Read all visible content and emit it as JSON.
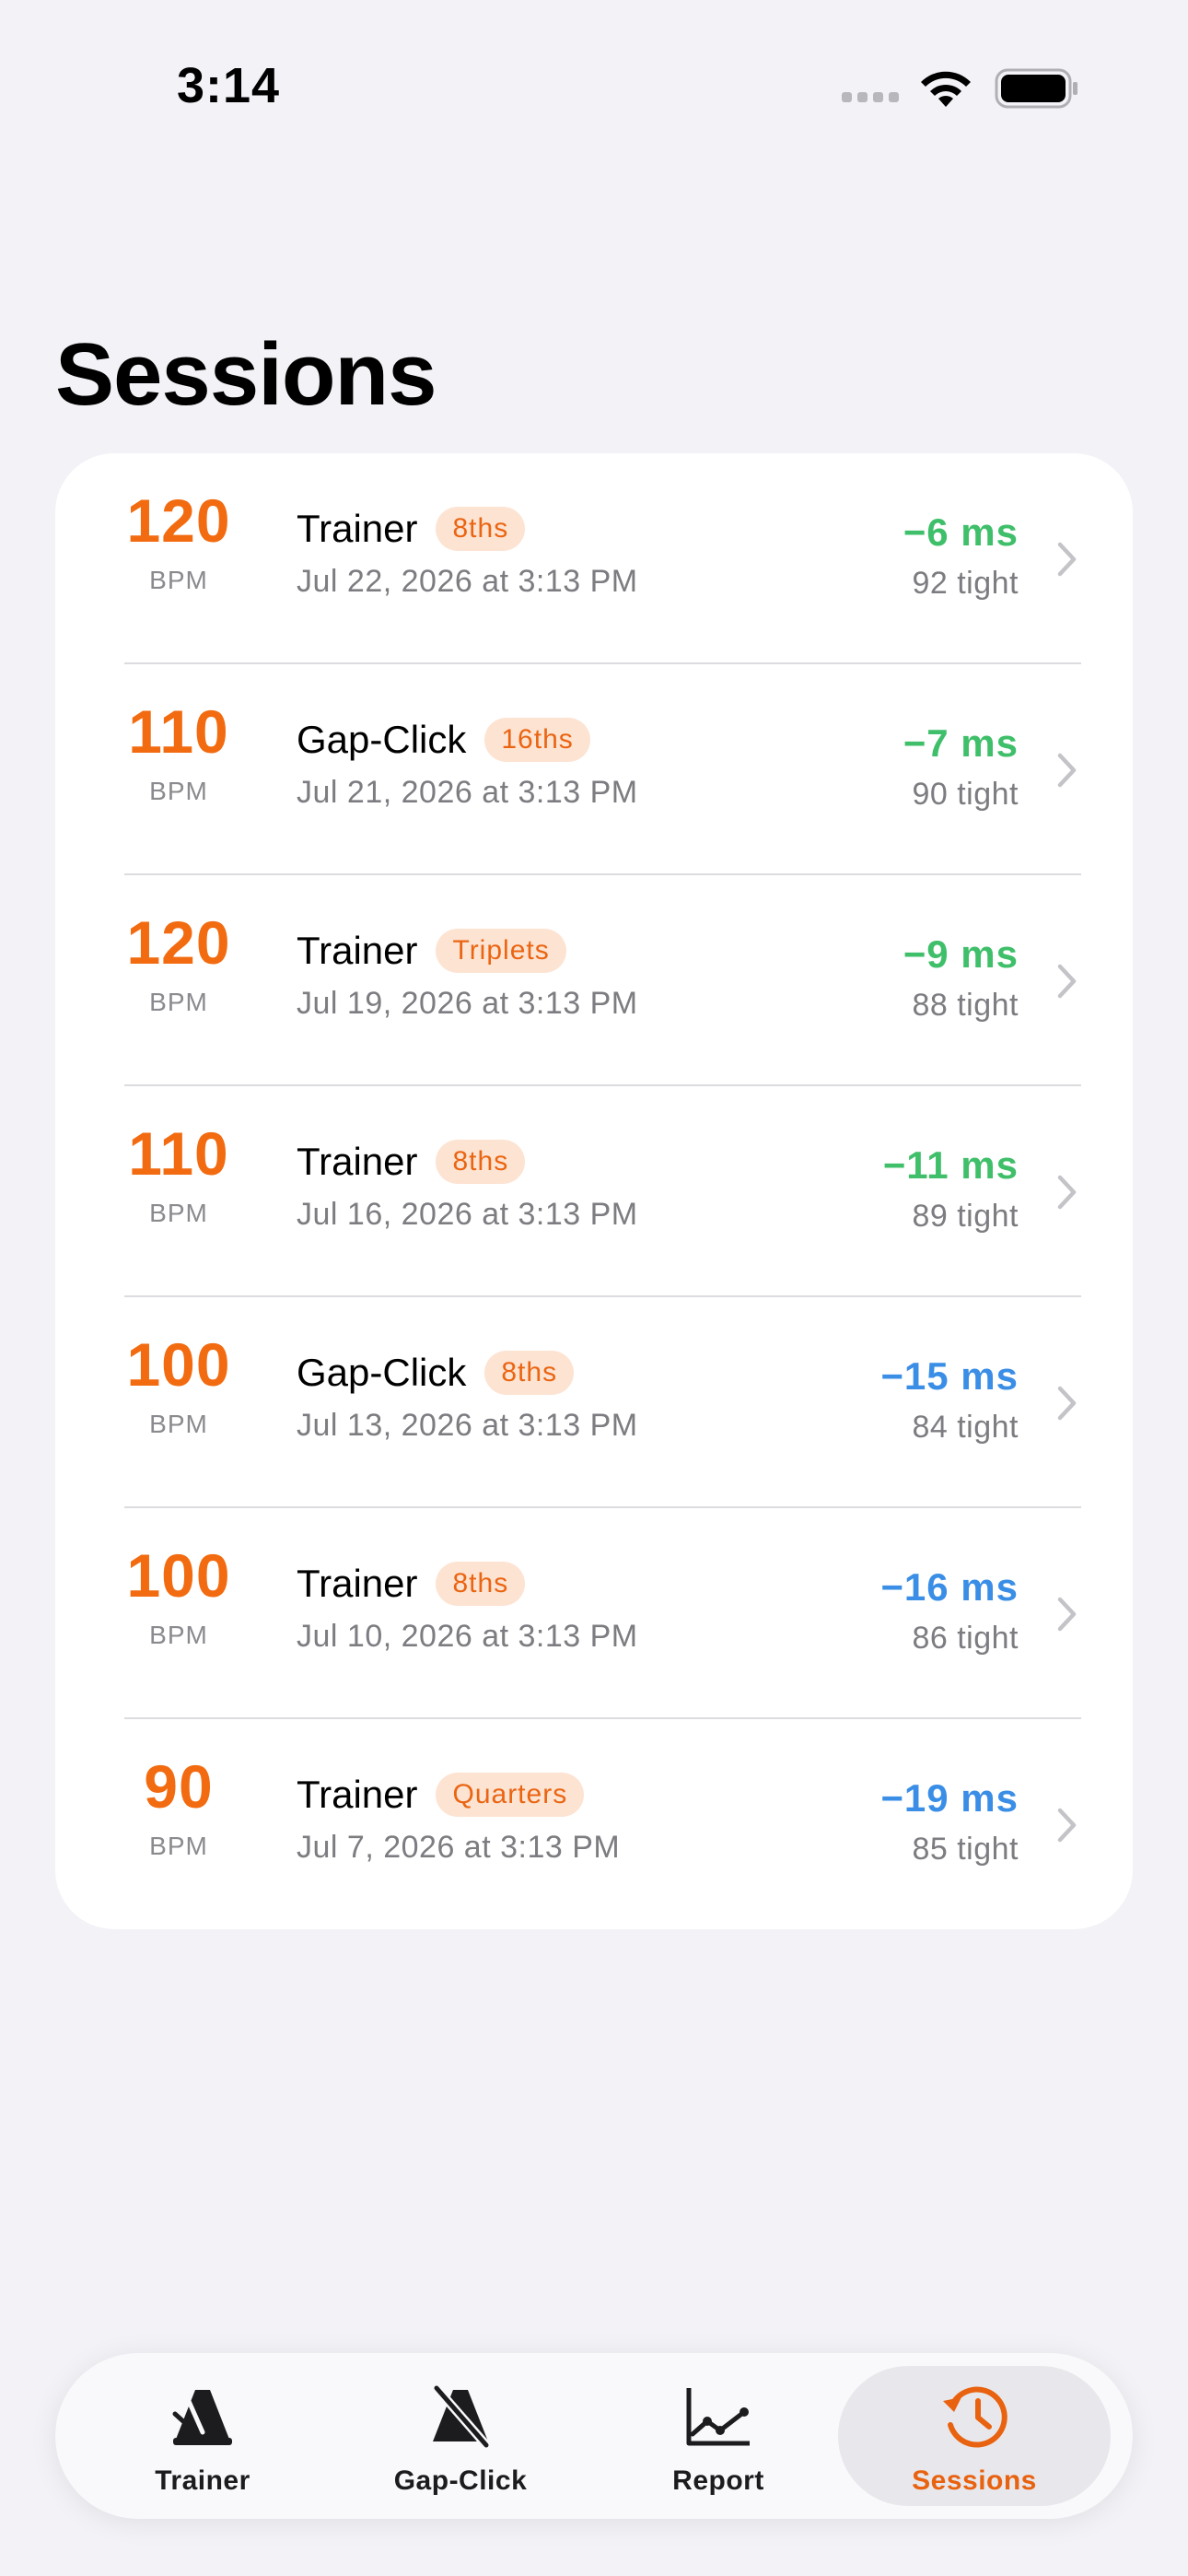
{
  "status_bar": {
    "time": "3:14"
  },
  "page": {
    "title": "Sessions"
  },
  "sessions": [
    {
      "bpm": "120",
      "unit": "BPM",
      "name": "Trainer",
      "subdivision": "8ths",
      "date": "Jul 22, 2026 at 3:13 PM",
      "offset": "−6 ms",
      "tight": "92 tight",
      "offset_color": "#3fbf6a"
    },
    {
      "bpm": "110",
      "unit": "BPM",
      "name": "Gap-Click",
      "subdivision": "16ths",
      "date": "Jul 21, 2026 at 3:13 PM",
      "offset": "−7 ms",
      "tight": "90 tight",
      "offset_color": "#3fbf6a"
    },
    {
      "bpm": "120",
      "unit": "BPM",
      "name": "Trainer",
      "subdivision": "Triplets",
      "date": "Jul 19, 2026 at 3:13 PM",
      "offset": "−9 ms",
      "tight": "88 tight",
      "offset_color": "#3fbf6a"
    },
    {
      "bpm": "110",
      "unit": "BPM",
      "name": "Trainer",
      "subdivision": "8ths",
      "date": "Jul 16, 2026 at 3:13 PM",
      "offset": "−11 ms",
      "tight": "89 tight",
      "offset_color": "#3fbf6a"
    },
    {
      "bpm": "100",
      "unit": "BPM",
      "name": "Gap-Click",
      "subdivision": "8ths",
      "date": "Jul 13, 2026 at 3:13 PM",
      "offset": "−15 ms",
      "tight": "84 tight",
      "offset_color": "#3a8ee6"
    },
    {
      "bpm": "100",
      "unit": "BPM",
      "name": "Trainer",
      "subdivision": "8ths",
      "date": "Jul 10, 2026 at 3:13 PM",
      "offset": "−16 ms",
      "tight": "86 tight",
      "offset_color": "#3a8ee6"
    },
    {
      "bpm": "90",
      "unit": "BPM",
      "name": "Trainer",
      "subdivision": "Quarters",
      "date": "Jul 7, 2026 at 3:13 PM",
      "offset": "−19 ms",
      "tight": "85 tight",
      "offset_color": "#3a8ee6"
    }
  ],
  "tab_bar": {
    "active": "sessions",
    "items": [
      {
        "id": "trainer",
        "label": "Trainer",
        "icon": "metronome-icon"
      },
      {
        "id": "gap-click",
        "label": "Gap-Click",
        "icon": "metronome-slash-icon"
      },
      {
        "id": "report",
        "label": "Report",
        "icon": "chart-line-icon"
      },
      {
        "id": "sessions",
        "label": "Sessions",
        "icon": "clock-history-icon"
      }
    ]
  },
  "colors": {
    "accent": "#f26b10",
    "good": "#3fbf6a",
    "ok": "#3a8ee6",
    "background": "#f2f2f7"
  }
}
